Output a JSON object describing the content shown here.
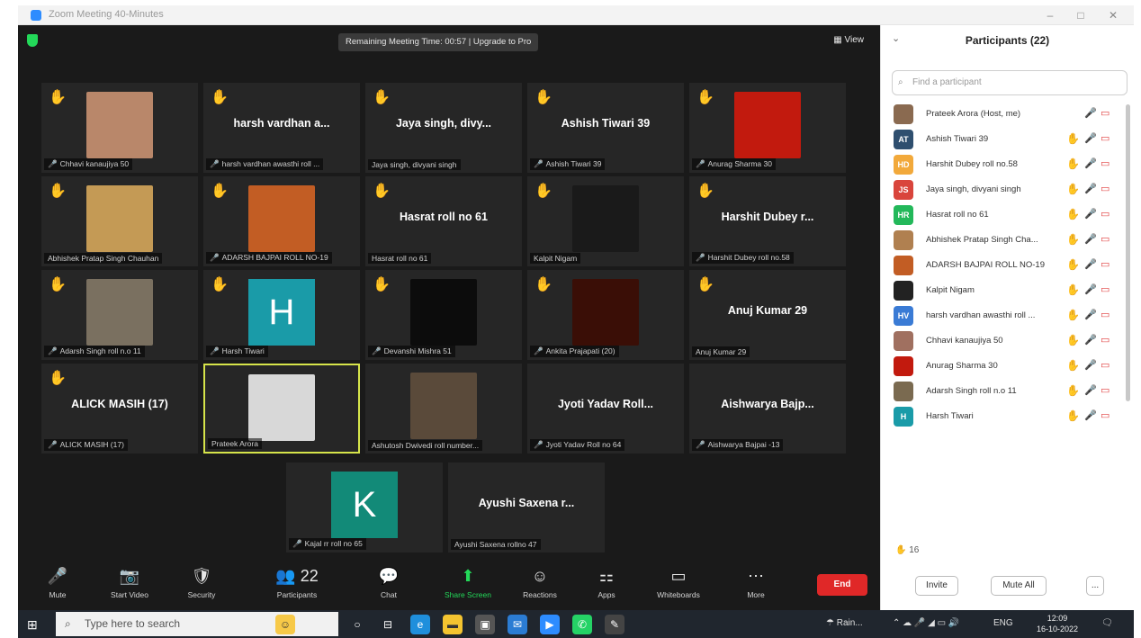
{
  "window": {
    "title": "Zoom Meeting 40-Minutes"
  },
  "topbar": {
    "remaining": "Remaining Meeting Time: 00:57 | Upgrade to Pro",
    "view_label": "View"
  },
  "tiles": [
    {
      "label": "Chhavi kanaujiya 50",
      "bigname": "",
      "hand": true,
      "mic_off": true,
      "photo": "#b9876a"
    },
    {
      "label": "harsh vardhan awasthi roll ...",
      "bigname": "harsh vardhan a...",
      "hand": true,
      "mic_off": true
    },
    {
      "label": "Jaya singh, divyani singh",
      "bigname": "Jaya singh, divy...",
      "hand": true,
      "mic_off": false
    },
    {
      "label": "Ashish Tiwari 39",
      "bigname": "Ashish Tiwari 39",
      "hand": true,
      "mic_off": true
    },
    {
      "label": "Anurag Sharma 30",
      "bigname": "",
      "hand": true,
      "mic_off": true,
      "photo": "#c21a0e"
    },
    {
      "label": "Abhishek Pratap Singh Chauhan",
      "bigname": "",
      "hand": true,
      "mic_off": false,
      "photo": "#c49a55"
    },
    {
      "label": "ADARSH BAJPAI ROLL NO-19",
      "bigname": "",
      "hand": true,
      "mic_off": true,
      "photo": "#c25d24"
    },
    {
      "label": "Hasrat roll no 61",
      "bigname": "Hasrat roll no 61",
      "hand": true,
      "mic_off": false
    },
    {
      "label": "Kalpit Nigam",
      "bigname": "",
      "hand": true,
      "mic_off": false,
      "photo": "#1a1a1a"
    },
    {
      "label": "Harshit Dubey  roll no.58",
      "bigname": "Harshit Dubey  r...",
      "hand": true,
      "mic_off": true
    },
    {
      "label": "Adarsh Singh roll n.o 11",
      "bigname": "",
      "hand": true,
      "mic_off": true,
      "photo": "#7a7060"
    },
    {
      "label": "Harsh Tiwari",
      "bigname": "",
      "hand": true,
      "mic_off": true,
      "letter": "H",
      "letter_color": "#1a9ba8"
    },
    {
      "label": "Devanshi Mishra 51",
      "bigname": "",
      "hand": true,
      "mic_off": true,
      "photo": "#0c0c0c"
    },
    {
      "label": "Ankita Prajapati (20)",
      "bigname": "",
      "hand": true,
      "mic_off": true,
      "photo": "#3a0e06"
    },
    {
      "label": "Anuj Kumar 29",
      "bigname": "Anuj Kumar 29",
      "hand": true,
      "mic_off": false
    },
    {
      "label": "ALICK MASIH (17)",
      "bigname": "ALICK MASIH (17)",
      "hand": true,
      "mic_off": true
    },
    {
      "label": "Prateek Arora",
      "bigname": "",
      "hand": false,
      "mic_off": false,
      "photo": "#d8d8d8"
    },
    {
      "label": "Ashutosh Dwivedi roll number...",
      "bigname": "",
      "hand": false,
      "mic_off": false,
      "photo": "#5a4a3a"
    },
    {
      "label": "Jyoti Yadav Roll no 64",
      "bigname": "Jyoti Yadav Roll...",
      "hand": false,
      "mic_off": true
    },
    {
      "label": "Aishwarya Bajpai -13",
      "bigname": "Aishwarya Bajp...",
      "hand": false,
      "mic_off": true
    },
    {
      "label": "Kajal rr roll no 65",
      "bigname": "",
      "hand": false,
      "mic_off": true,
      "letter": "K",
      "letter_color": "#128a78"
    },
    {
      "label": "Ayushi Saxena rollno 47",
      "bigname": "Ayushi Saxena r...",
      "hand": false,
      "mic_off": false
    }
  ],
  "controls": [
    {
      "icon": "🎤",
      "label": "Mute",
      "name": "mute-button"
    },
    {
      "icon": "📷",
      "label": "Start Video",
      "name": "start-video-button"
    },
    {
      "icon": "🛡",
      "label": "Security",
      "name": "security-button"
    },
    {
      "icon": "👥",
      "label": "Participants",
      "name": "participants-button",
      "badge": "22"
    },
    {
      "icon": "💬",
      "label": "Chat",
      "name": "chat-button"
    },
    {
      "icon": "⬆",
      "label": "Share Screen",
      "name": "share-screen-button",
      "green": true
    },
    {
      "icon": "☺",
      "label": "Reactions",
      "name": "reactions-button"
    },
    {
      "icon": "⚏",
      "label": "Apps",
      "name": "apps-button"
    },
    {
      "icon": "▭",
      "label": "Whiteboards",
      "name": "whiteboards-button"
    },
    {
      "icon": "⋯",
      "label": "More",
      "name": "more-button"
    }
  ],
  "end_label": "End",
  "panel": {
    "title": "Participants (22)",
    "search_placeholder": "Find a participant",
    "participants": [
      {
        "name": "Prateek Arora (Host, me)",
        "initials": "",
        "color": "#8a6a50",
        "hand": false
      },
      {
        "name": "Ashish Tiwari 39",
        "initials": "AT",
        "color": "#2f4f6f",
        "hand": true
      },
      {
        "name": "Harshit Dubey  roll no.58",
        "initials": "HD",
        "color": "#f2a93b",
        "hand": true
      },
      {
        "name": "Jaya singh, divyani singh",
        "initials": "JS",
        "color": "#d9453c",
        "hand": true
      },
      {
        "name": "Hasrat roll no 61",
        "initials": "HR",
        "color": "#23b85a",
        "hand": true
      },
      {
        "name": "Abhishek Pratap Singh Cha...",
        "initials": "",
        "color": "#b08050",
        "hand": true
      },
      {
        "name": "ADARSH BAJPAI ROLL NO-19",
        "initials": "",
        "color": "#c25d24",
        "hand": true
      },
      {
        "name": "Kalpit Nigam",
        "initials": "",
        "color": "#222222",
        "hand": true
      },
      {
        "name": "harsh vardhan awasthi roll ...",
        "initials": "HV",
        "color": "#3a7bd5",
        "hand": true
      },
      {
        "name": "Chhavi kanaujiya 50",
        "initials": "",
        "color": "#a07060",
        "hand": true
      },
      {
        "name": "Anurag Sharma 30",
        "initials": "",
        "color": "#c21a0e",
        "hand": true
      },
      {
        "name": "Adarsh Singh roll n.o 11",
        "initials": "",
        "color": "#7a6a50",
        "hand": true
      },
      {
        "name": "Harsh Tiwari",
        "initials": "H",
        "color": "#1a9ba8",
        "hand": true
      }
    ],
    "raised_count": "16",
    "invite_label": "Invite",
    "mute_all_label": "Mute All",
    "more_label": "..."
  },
  "taskbar": {
    "search_placeholder": "Type here to search",
    "rain_label": "Rain...",
    "lang": "ENG",
    "time": "12:09",
    "date": "16-10-2022"
  }
}
